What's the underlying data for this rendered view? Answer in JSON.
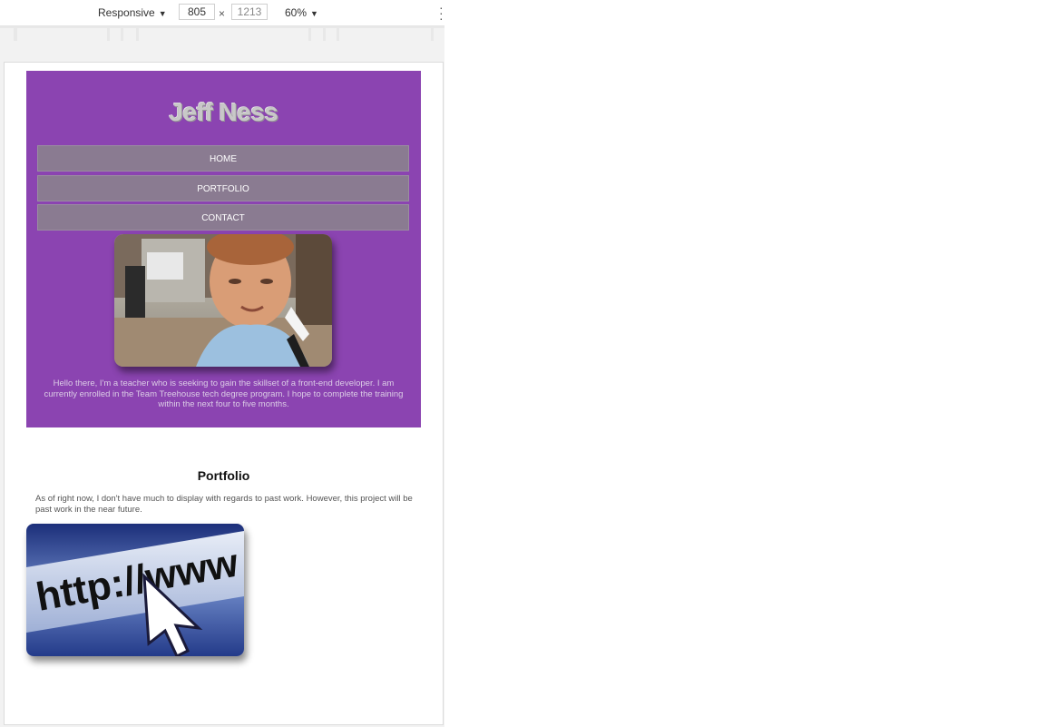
{
  "devtools": {
    "mode_label": "Responsive",
    "width_value": "805",
    "height_value": "1213",
    "dims_separator": "×",
    "zoom_label": "60%"
  },
  "site": {
    "title": "Jeff Ness",
    "nav": {
      "home": "HOME",
      "portfolio": "PORTFOLIO",
      "contact": "CONTACT"
    },
    "intro": "Hello there, I'm a teacher who is seeking to gain the skillset of a front-end developer. I am currently enrolled in the Team Treehouse tech degree program. I hope to complete the training within the next four to five months.",
    "portfolio": {
      "heading": "Portfolio",
      "text": "As of right now, I don't have much to display with regards to past work. However, this project will be past work in the near future.",
      "image_text": "http://www"
    }
  },
  "colors": {
    "header_bg": "#8b44b1",
    "nav_bg": "#8a7b91"
  },
  "icons": {
    "more": "more-vertical-icon",
    "dropdown": "triangle-down-icon",
    "cursor": "cursor-arrow-icon"
  }
}
